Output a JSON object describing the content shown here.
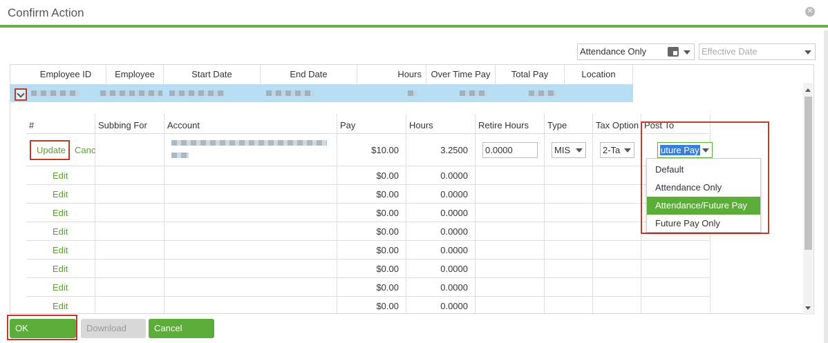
{
  "window": {
    "title": "Confirm Action"
  },
  "filters": {
    "post_to_value": "Attendance Only",
    "effective_date_placeholder": "Effective Date"
  },
  "master": {
    "columns": [
      "Employee ID",
      "Employee",
      "Start Date",
      "End Date",
      "Hours",
      "Over Time Pay",
      "Total Pay",
      "Location"
    ]
  },
  "detail": {
    "columns": [
      "#",
      "Subbing For",
      "Account",
      "Pay",
      "Hours",
      "Retire Hours",
      "Type",
      "Tax Option",
      "Post To"
    ],
    "edit_row": {
      "update_label": "Update",
      "cancel_label": "Canc",
      "pay": "$10.00",
      "hours": "3.2500",
      "retire_hours": "0.0000",
      "type": "MIS",
      "tax_option": "2-Ta",
      "post_to": "uture Pay"
    },
    "rows": [
      {
        "action": "Edit",
        "pay": "$0.00",
        "hours": "0.0000"
      },
      {
        "action": "Edit",
        "pay": "$0.00",
        "hours": "0.0000"
      },
      {
        "action": "Edit",
        "pay": "$0.00",
        "hours": "0.0000"
      },
      {
        "action": "Edit",
        "pay": "$0.00",
        "hours": "0.0000"
      },
      {
        "action": "Edit",
        "pay": "$0.00",
        "hours": "0.0000"
      },
      {
        "action": "Edit",
        "pay": "$0.00",
        "hours": "0.0000"
      },
      {
        "action": "Edit",
        "pay": "$0.00",
        "hours": "0.0000"
      },
      {
        "action": "Edit",
        "pay": "$0.00",
        "hours": "0.0000"
      }
    ]
  },
  "post_to_dropdown": {
    "options": [
      "Default",
      "Attendance Only",
      "Attendance/Future Pay",
      "Future Pay Only"
    ],
    "selected": "Attendance/Future Pay"
  },
  "footer": {
    "ok_label": "OK",
    "download_label": "Download",
    "cancel_label": "Cancel"
  },
  "colors": {
    "accent": "#5cac3a",
    "selected_row": "#b7def2",
    "highlight": "#c0392b"
  }
}
